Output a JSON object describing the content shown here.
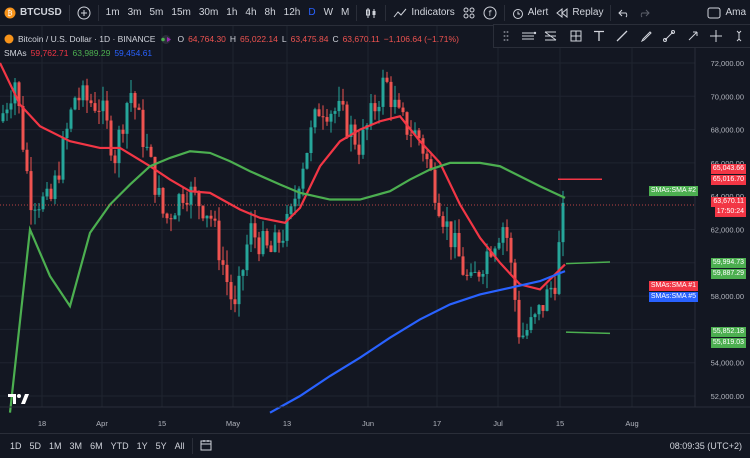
{
  "toolbar": {
    "symbol": "BTCUSD",
    "timeframes": [
      "1m",
      "3m",
      "5m",
      "15m",
      "30m",
      "1h",
      "4h",
      "8h",
      "12h",
      "D",
      "W",
      "M"
    ],
    "active_timeframe": "D",
    "indicators_label": "Indicators",
    "alert_label": "Alert",
    "replay_label": "Replay",
    "layout_label": "Ama"
  },
  "legend": {
    "title": "Bitcoin / U.S. Dollar · 1D · BINANCE",
    "ohlc": {
      "o_label": "O",
      "o": "64,764.30",
      "h_label": "H",
      "h": "65,022.14",
      "l_label": "L",
      "l": "63,475.84",
      "c_label": "C",
      "c": "63,670.11",
      "change": "−1,106.64 (−1.71%)"
    },
    "sma_label": "SMAs",
    "sma_values": [
      "59,762.71",
      "63,989.29",
      "59,454.61"
    ],
    "sma_colors": [
      "#f23645",
      "#4caf50",
      "#2962ff"
    ]
  },
  "price_axis": {
    "ticks": [
      "72,000.00",
      "70,000.00",
      "68,000.00",
      "66,000.00",
      "64,000.00",
      "62,000.00",
      "60,000.00",
      "58,000.00",
      "56,000.00",
      "54,000.00",
      "52,000.00"
    ],
    "tags": {
      "t1": "65,043.66",
      "t2": "65,016.70",
      "sma2_label": "SMAs:SMA #2",
      "price": "63,670.11",
      "countdown": "17:50:24",
      "t3": "59,994.73",
      "t4": "59,887.29",
      "sma1_label": "SMAs:SMA #1",
      "sma5_label": "SMAs:SMA #5",
      "t5": "55,852.18",
      "t6": "55,819.03"
    }
  },
  "time_axis": [
    "18",
    "Apr",
    "15",
    "May",
    "13",
    "Jun",
    "17",
    "Jul",
    "15",
    "Aug"
  ],
  "bottom": {
    "ranges": [
      "1D",
      "5D",
      "1M",
      "3M",
      "6M",
      "YTD",
      "1Y",
      "5Y",
      "All"
    ],
    "clock": "08:09:35 (UTC+2)"
  },
  "colors": {
    "up": "#26a69a",
    "down": "#ef5350",
    "bg": "#131722",
    "sma1": "#f23645",
    "sma2": "#4caf50",
    "sma5": "#2962ff"
  }
}
